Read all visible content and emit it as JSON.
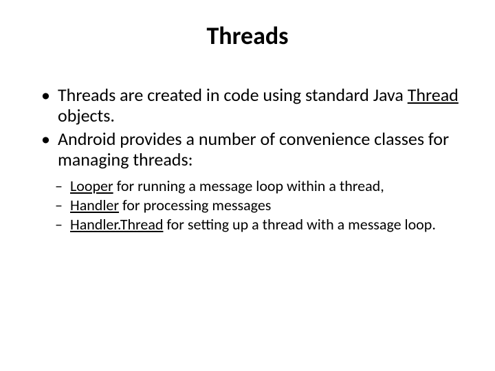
{
  "title": "Threads",
  "bullets": [
    {
      "pre": "Threads are created in code using standard Java ",
      "link": "Thread",
      "post": " objects."
    },
    {
      "pre": "Android provides a number of convenience classes for managing threads:",
      "link": "",
      "post": ""
    }
  ],
  "subs": [
    {
      "link": "Looper",
      "post": " for running a message loop within a thread,"
    },
    {
      "link": "Handler",
      "post": " for processing messages"
    },
    {
      "link": "Handler.Thread",
      "post": " for setting up a thread with a message loop."
    }
  ]
}
